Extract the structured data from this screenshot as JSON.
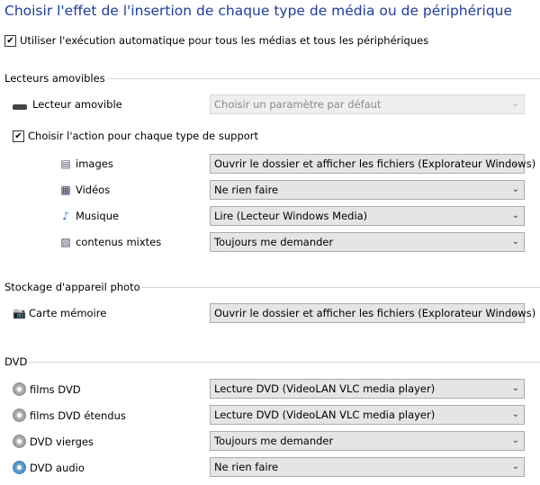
{
  "title": "Choisir l'effet de l'insertion de chaque type de média ou de périphérique",
  "autoplay": {
    "label": "Utiliser l'exécution automatique pour tous les médias et tous les périphériques",
    "checked": true
  },
  "removable": {
    "heading": "Lecteurs amovibles",
    "drive": {
      "label": "Lecteur amovible",
      "value": "Choisir un paramètre par défaut"
    },
    "per_type": {
      "label": "Choisir l'action pour chaque type de support",
      "checked": true
    },
    "items": [
      {
        "label": "images",
        "value": "Ouvrir le dossier et afficher les fichiers (Explorateur Windows)",
        "icon": "image-file-icon"
      },
      {
        "label": "Vidéos",
        "value": "Ne rien faire",
        "icon": "video-file-icon"
      },
      {
        "label": "Musique",
        "value": "Lire (Lecteur Windows Media)",
        "icon": "music-file-icon"
      },
      {
        "label": "contenus mixtes",
        "value": "Toujours me demander",
        "icon": "mixed-content-icon"
      }
    ]
  },
  "camera": {
    "heading": "Stockage d'appareil photo",
    "items": [
      {
        "label": "Carte mémoire",
        "value": "Ouvrir le dossier et afficher les fichiers (Explorateur Windows)"
      }
    ]
  },
  "dvd": {
    "heading": "DVD",
    "items": [
      {
        "label": "films DVD",
        "value": "Lecture DVD (VideoLAN VLC media player)"
      },
      {
        "label": "films DVD étendus",
        "value": "Lecture DVD (VideoLAN VLC media player)"
      },
      {
        "label": "DVD vierges",
        "value": "Toujours me demander"
      },
      {
        "label": "DVD audio",
        "value": "Ne rien faire"
      }
    ]
  },
  "chevron": "⌄"
}
